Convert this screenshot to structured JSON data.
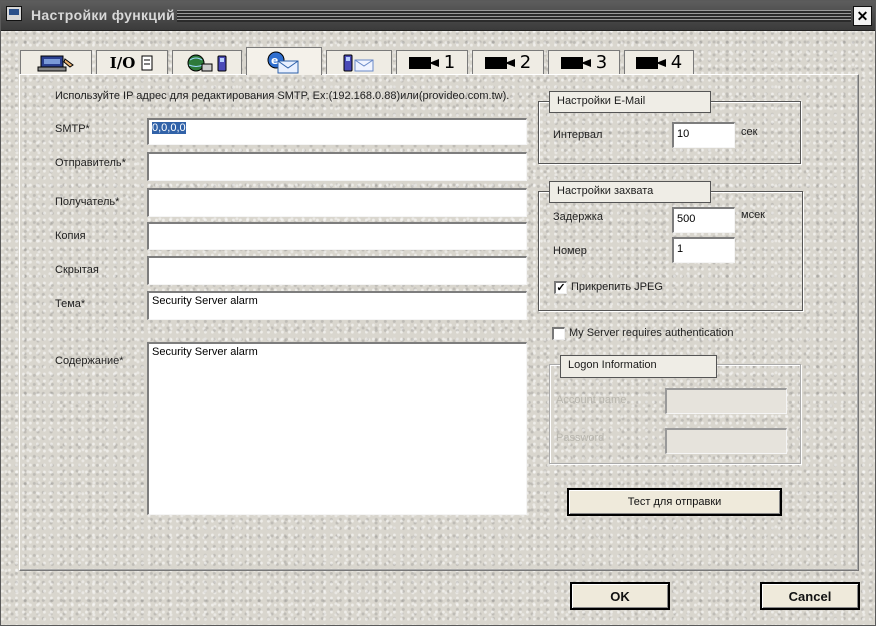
{
  "window": {
    "title": "Настройки функций",
    "close_glyph": "✕"
  },
  "tabs": [
    {
      "name": "network",
      "icon": "network-config-icon",
      "label": ""
    },
    {
      "name": "io",
      "icon": "io-icon",
      "label": "I/O"
    },
    {
      "name": "remote",
      "icon": "globe-phone-icon",
      "label": ""
    },
    {
      "name": "email",
      "icon": "email-icon",
      "label": "",
      "active": true
    },
    {
      "name": "sms",
      "icon": "phone-mail-icon",
      "label": ""
    },
    {
      "name": "camera1",
      "icon": "camera-icon",
      "label": "1"
    },
    {
      "name": "camera2",
      "icon": "camera-icon",
      "label": "2"
    },
    {
      "name": "camera3",
      "icon": "camera-icon",
      "label": "3"
    },
    {
      "name": "camera4",
      "icon": "camera-icon",
      "label": "4"
    }
  ],
  "email_form": {
    "hint": "Используйте IP адрес для редактирования SMTP, Ex:(192.168.0.88)или(provideo.com.tw).",
    "smtp_label": "SMTP*",
    "smtp_value": "0,0,0,0",
    "sender_label": "Отправитель*",
    "sender_value": "",
    "recipient_label": "Получатель*",
    "recipient_value": "",
    "cc_label": "Копия",
    "cc_value": "",
    "bcc_label": "Скрытая",
    "bcc_value": "",
    "subject_label": "Тема*",
    "subject_value": "Security Server alarm",
    "body_label": "Содержание*",
    "body_value": "Security Server alarm"
  },
  "email_settings": {
    "title": "Настройки E-Mail",
    "interval_label": "Интервал",
    "interval_value": "10",
    "interval_unit": "сек"
  },
  "capture_settings": {
    "title": "Настройки захвата",
    "delay_label": "Задержка",
    "delay_value": "500",
    "delay_unit": "мсек",
    "number_label": "Номер",
    "number_value": "1",
    "attach_jpeg_label": "Прикрепить JPEG",
    "attach_jpeg_checked": true,
    "check_glyph": "✓"
  },
  "auth": {
    "requires_auth_label": "My Server requires authentication",
    "requires_auth_checked": false,
    "logon_title": "Logon Information",
    "account_label": "Account name",
    "account_value": "",
    "password_label": "Password",
    "password_value": ""
  },
  "buttons": {
    "test_send": "Тест для отправки",
    "ok": "OK",
    "cancel": "Cancel"
  },
  "colors": {
    "titlebar": "#4a4a4a",
    "selection": "#3162a8",
    "button_face": "#efeadb"
  }
}
